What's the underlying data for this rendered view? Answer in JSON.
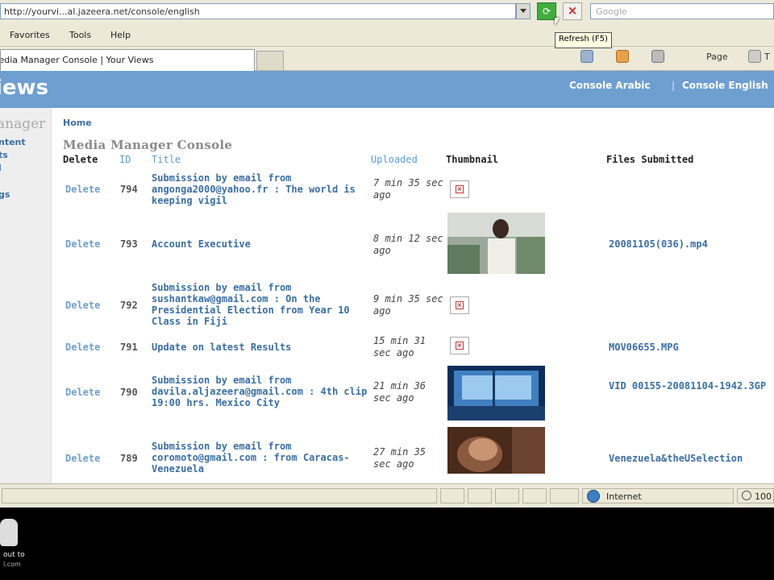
{
  "browser": {
    "address": "http://yourvi...al.jazeera.net/console/english",
    "search_placeholder": "Google",
    "tooltip": "Refresh (F5)",
    "menu": [
      "Favorites",
      "Tools",
      "Help"
    ],
    "tab_title": "Media Manager Console | Your Views",
    "tools": {
      "page": "Page",
      "tools": "T"
    }
  },
  "site": {
    "logo": "iews",
    "lang_arabic": "Console Arabic",
    "lang_sep": "|",
    "lang_english": "Console English"
  },
  "sidebar": {
    "title": "anager",
    "items": [
      "ntent",
      "ts",
      "l",
      "gs"
    ]
  },
  "breadcrumb": "Home",
  "page_title": "Media Manager Console",
  "table": {
    "headers": {
      "delete": "Delete",
      "id": "ID",
      "title": "Title",
      "uploaded": "Uploaded",
      "thumbnail": "Thumbnail",
      "files": "Files Submitted"
    },
    "rows": [
      {
        "delete": "Delete",
        "id": "794",
        "title": "Submission by email from angonga2000@yahoo.fr : The world is keeping vigil",
        "uploaded": "7 min 35 sec ago",
        "thumb": "broken",
        "file": ""
      },
      {
        "delete": "Delete",
        "id": "793",
        "title": "Account Executive",
        "uploaded": "8 min 12 sec ago",
        "thumb": "image",
        "file": "20081105(036).mp4"
      },
      {
        "delete": "Delete",
        "id": "792",
        "title": "Submission by email from sushantkaw@gmail.com : On the Presidential Election from Year 10 Class in Fiji",
        "uploaded": "9 min 35 sec ago",
        "thumb": "broken",
        "file": ""
      },
      {
        "delete": "Delete",
        "id": "791",
        "title": "Update on latest Results",
        "uploaded": "15 min 31 sec ago",
        "thumb": "broken",
        "file": "MOV06655.MPG"
      },
      {
        "delete": "Delete",
        "id": "790",
        "title": "Submission by email from davila.aljazeera@gmail.com : 4th clip 19:00 hrs. Mexico City",
        "uploaded": "21 min 36 sec ago",
        "thumb": "image",
        "file": "VID 00155-20081104-1942.3GP"
      },
      {
        "delete": "Delete",
        "id": "789",
        "title": "Submission by email from coromoto@gmail.com : from Caracas-Venezuela",
        "uploaded": "27 min 35 sec ago",
        "thumb": "image",
        "file": "Venezuela&theUSelection"
      }
    ]
  },
  "statusbar": {
    "zone": "Internet",
    "zoom": "100"
  },
  "overlay": {
    "caption1": "out to",
    "caption2": "l.com"
  },
  "colors": {
    "banner": "#6f9fd0",
    "link": "#3a6ea5",
    "chrome": "#ece9d8"
  }
}
